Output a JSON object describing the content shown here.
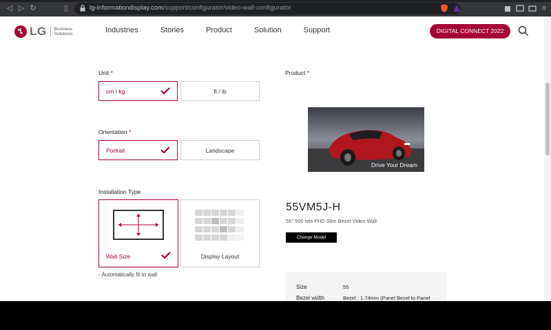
{
  "browser": {
    "url_host": "lg-informationdisplay.com",
    "url_path": "/support/configurator/video-wall-configurator"
  },
  "header": {
    "logo_text": "LG",
    "logo_sub_line1": "Business",
    "logo_sub_line2": "Solutions",
    "nav": [
      "Industries",
      "Stories",
      "Product",
      "Solution",
      "Support"
    ],
    "cta_label": "DIGITAL CONNECT 2022"
  },
  "config": {
    "unit_label": "Unit",
    "unit_options": [
      "cm / kg",
      "ft / lb"
    ],
    "orientation_label": "Orientation",
    "orientation_options": [
      "Portrait",
      "Landscape"
    ],
    "installation_label": "Installation Type",
    "installation_options": [
      "Wall Size",
      "Display Layout"
    ],
    "installation_note": "- Automatically fit to wall",
    "required_mark": "*"
  },
  "product": {
    "label": "Product",
    "image_caption": "Drive Your Dream",
    "model": "55VM5J-H",
    "description": "55\" 500 nits FHD Slim Bezel Video Wall",
    "change_button": "Change Model",
    "specs": [
      {
        "key": "Size",
        "value": "55"
      },
      {
        "key": "Bezel width",
        "value": "Bezel : 1.74mm (Panel Bezel to Panel"
      }
    ]
  },
  "colors": {
    "brand": "#a50034"
  }
}
